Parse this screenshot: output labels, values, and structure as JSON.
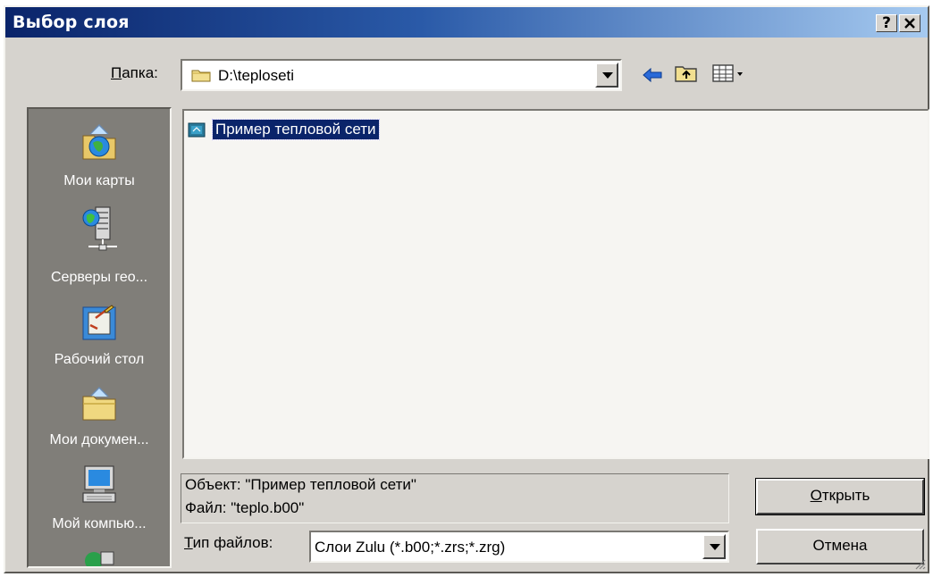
{
  "window": {
    "title": "Выбор слоя",
    "help_label": "?",
    "close_label": "✕"
  },
  "folder": {
    "label_prefix": "",
    "label_hotkey": "П",
    "label_rest": "апка:",
    "path": "D:\\teploseti"
  },
  "toolbar": {
    "back_icon": "back-arrow-icon",
    "up_icon": "up-folder-icon",
    "view_icon": "view-menu-icon"
  },
  "places": {
    "items": [
      {
        "label": "Мои карты",
        "icon": "my-maps-icon"
      },
      {
        "label": "Серверы гео...",
        "icon": "geo-servers-icon"
      },
      {
        "label": "Рабочий стол",
        "icon": "desktop-icon"
      },
      {
        "label": "Мои докумен...",
        "icon": "my-documents-icon"
      },
      {
        "label": "Мой компью...",
        "icon": "my-computer-icon"
      }
    ]
  },
  "files": [
    {
      "name": "Пример тепловой сети",
      "selected": true
    }
  ],
  "info": {
    "object_line": "Объект: \"Пример тепловой сети\"",
    "file_line": "Файл: \"teplo.b00\""
  },
  "filetype": {
    "label_hotkey": "Т",
    "label_rest": "ип файлов:",
    "value": "Слои Zulu (*.b00;*.zrs;*.zrg)"
  },
  "buttons": {
    "open_hotkey": "О",
    "open_rest": "ткрыть",
    "cancel": "Отмена"
  },
  "colors": {
    "title_start": "#0a246a",
    "title_end": "#a6caf0",
    "selection": "#0a246a",
    "face": "#d6d3ce",
    "places_bg": "#807e79"
  }
}
